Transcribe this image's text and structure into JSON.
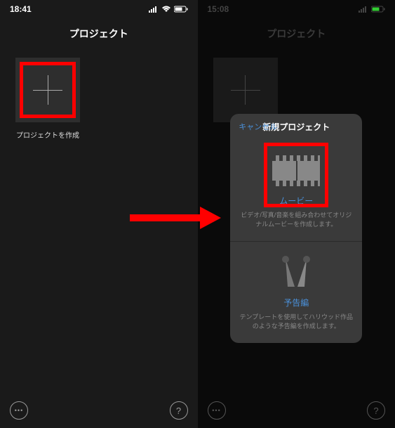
{
  "left": {
    "status_time": "18:41",
    "nav_title": "プロジェクト",
    "create_caption": "プロジェクトを作成"
  },
  "right": {
    "status_time": "15:08",
    "nav_title": "プロジェクト"
  },
  "modal": {
    "cancel": "キャンセル",
    "title": "新規プロジェクト",
    "movie": {
      "label": "ムービー",
      "desc": "ビデオ/写真/音楽を組み合わせてオリジナルムービーを作成します。"
    },
    "trailer": {
      "label": "予告編",
      "desc": "テンプレートを使用してハリウッド作品のような予告編を作成します。"
    }
  }
}
